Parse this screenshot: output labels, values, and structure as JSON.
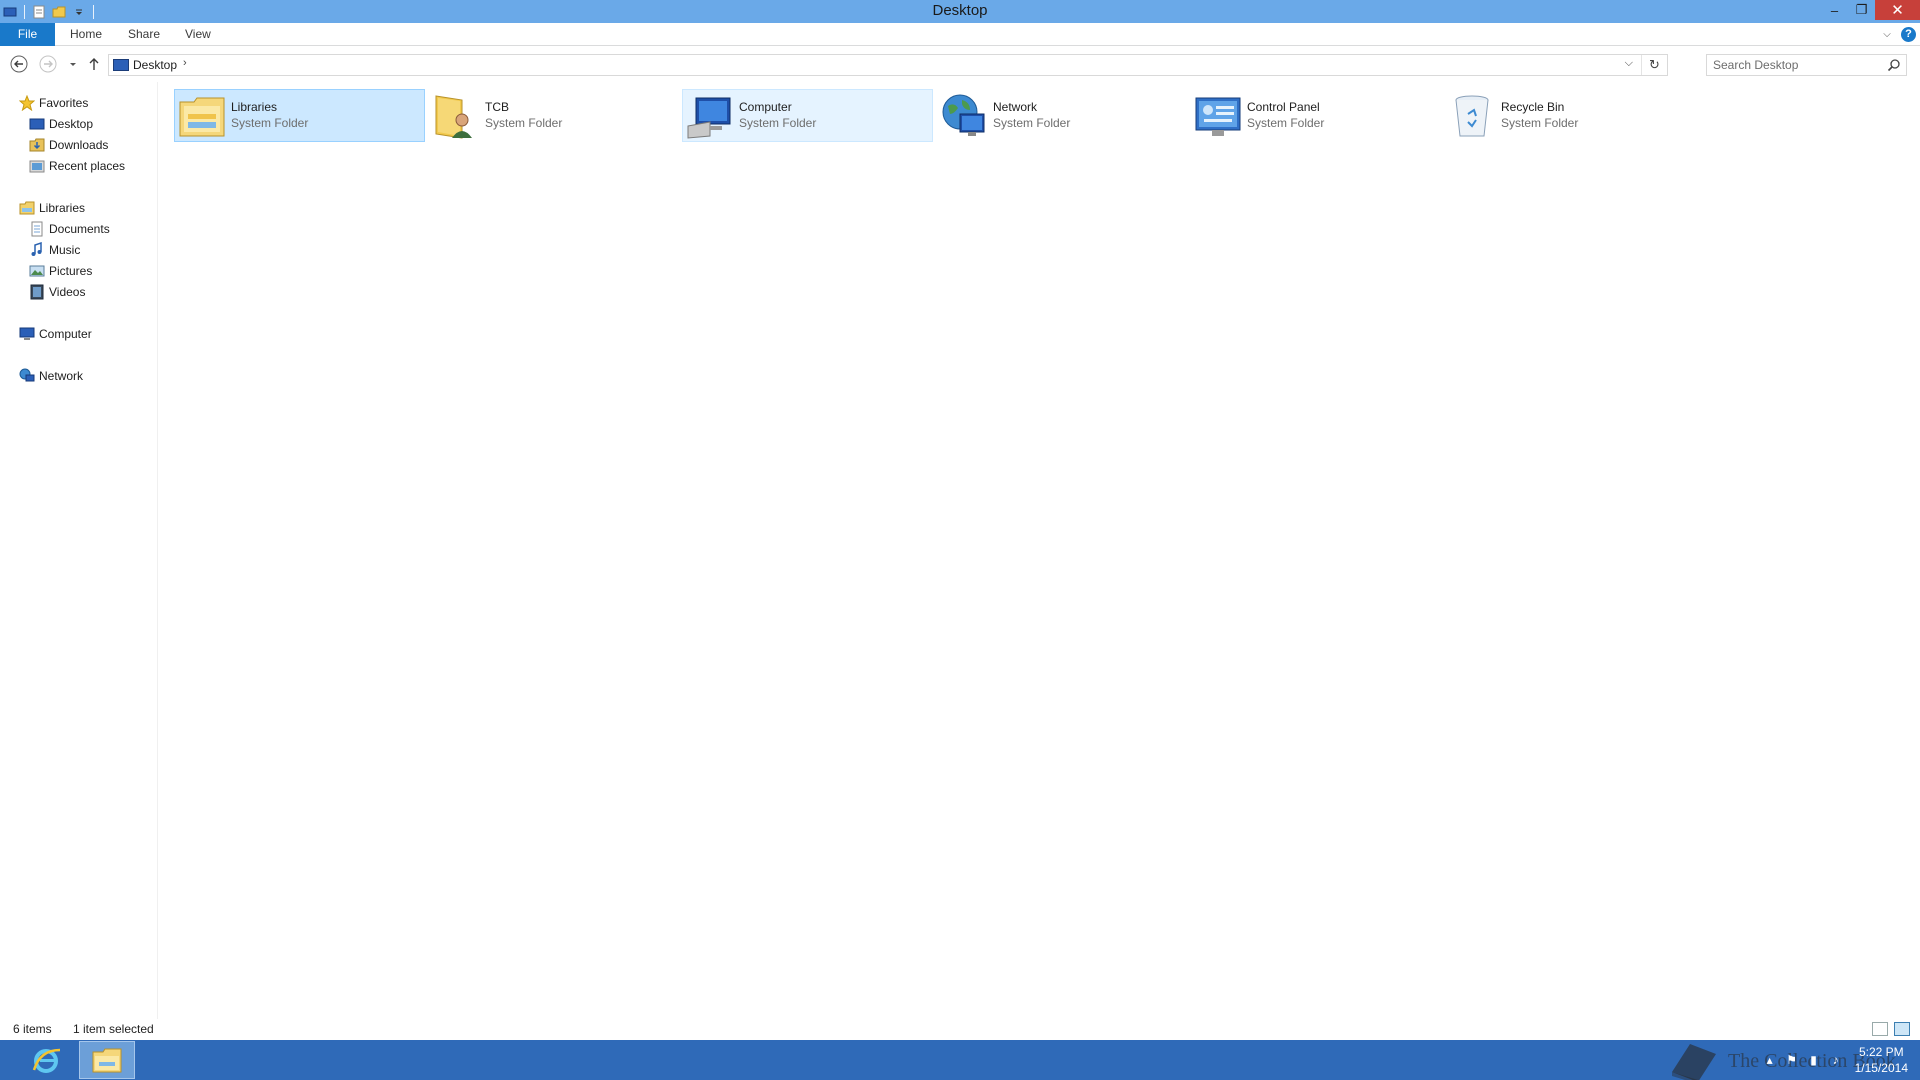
{
  "window": {
    "title": "Desktop"
  },
  "window_buttons": {
    "minimize": "–",
    "restore": "❐",
    "close": "✕"
  },
  "ribbon": {
    "tabs": [
      {
        "label": "File"
      },
      {
        "label": "Home"
      },
      {
        "label": "Share"
      },
      {
        "label": "View"
      }
    ],
    "help": "?"
  },
  "address": {
    "crumb": "Desktop",
    "separator": "›"
  },
  "search": {
    "placeholder": "Search Desktop"
  },
  "nav": {
    "favorites": "Favorites",
    "desktop": "Desktop",
    "downloads": "Downloads",
    "recent": "Recent places",
    "libraries": "Libraries",
    "documents": "Documents",
    "music": "Music",
    "pictures": "Pictures",
    "videos": "Videos",
    "computer": "Computer",
    "network": "Network"
  },
  "items": [
    {
      "name": "Libraries",
      "type": "System Folder",
      "icon": "libraries-icon",
      "state": "selected"
    },
    {
      "name": "TCB",
      "type": "System Folder",
      "icon": "user-folder-icon",
      "state": "normal"
    },
    {
      "name": "Computer",
      "type": "System Folder",
      "icon": "computer-icon",
      "state": "hover"
    },
    {
      "name": "Network",
      "type": "System Folder",
      "icon": "network-icon",
      "state": "normal"
    },
    {
      "name": "Control Panel",
      "type": "System Folder",
      "icon": "control-panel-icon",
      "state": "normal"
    },
    {
      "name": "Recycle Bin",
      "type": "System Folder",
      "icon": "recycle-bin-icon",
      "state": "normal"
    }
  ],
  "status": {
    "count": "6 items",
    "selection": "1 item selected"
  },
  "taskbar": {
    "apps": [
      "internet-explorer-icon",
      "file-explorer-icon"
    ],
    "clock_time": "5:22 PM",
    "clock_date": "1/15/2014",
    "watermark_text": "The Collection Book"
  },
  "colors": {
    "titlebar": "#6aa9e8",
    "file_tab": "#1979ca",
    "selection": "#cce8ff",
    "taskbar": "#2f6ab8",
    "close_button": "#c7403a"
  }
}
